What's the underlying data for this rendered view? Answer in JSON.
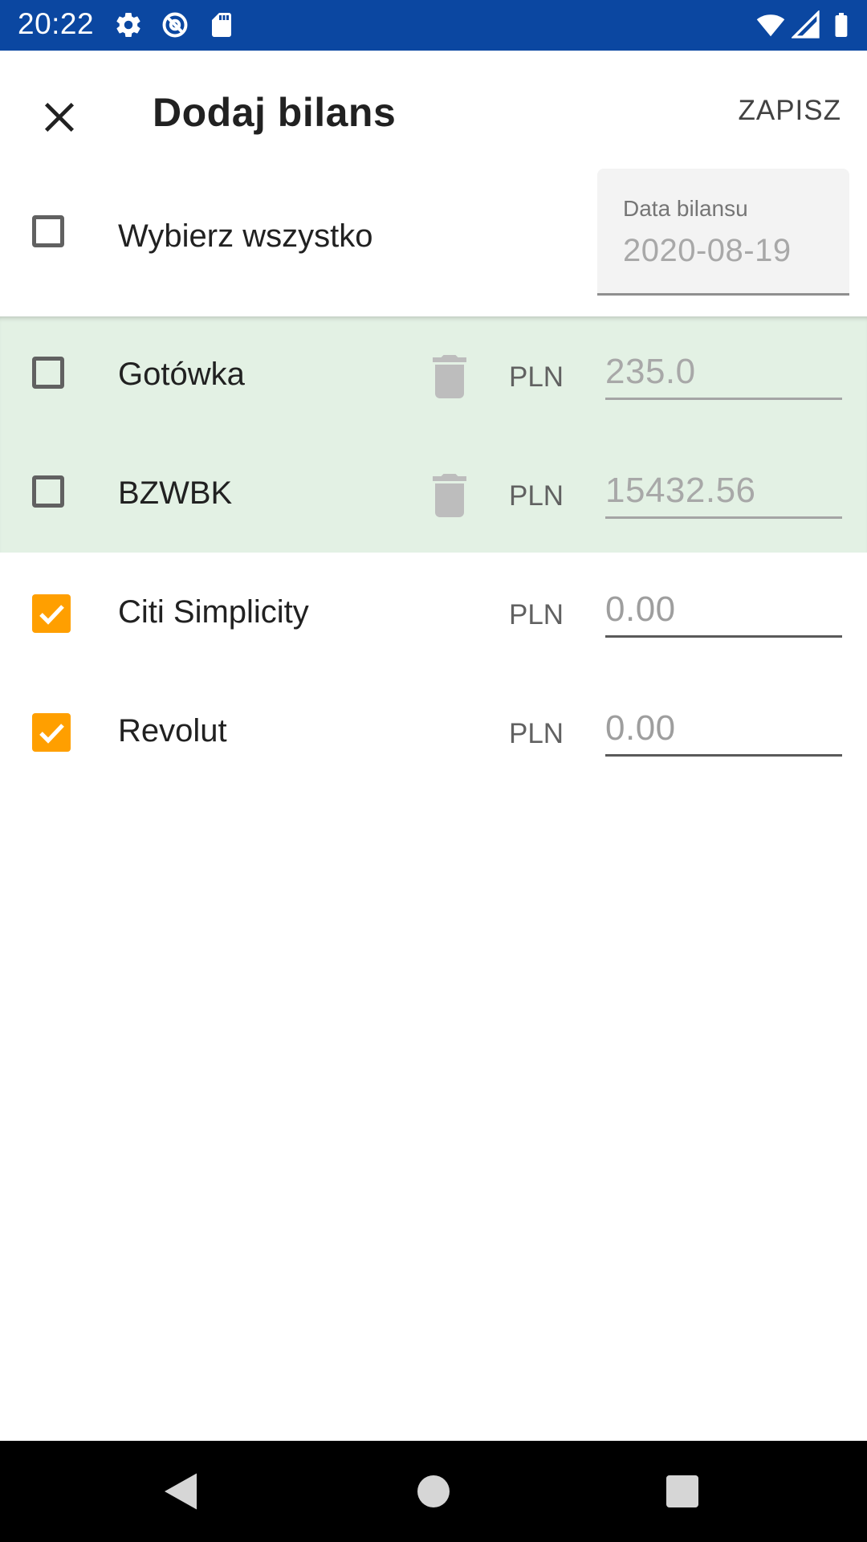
{
  "status_bar": {
    "time": "20:22",
    "icons": [
      "gear-icon",
      "vpn-icon",
      "sd-card-icon",
      "wifi-icon",
      "signal-icon",
      "battery-icon"
    ]
  },
  "app_bar": {
    "close_icon": "close-icon",
    "title": "Dodaj bilans",
    "save_label": "ZAPISZ"
  },
  "select_all": {
    "label": "Wybierz wszystko",
    "checked": false
  },
  "date_field": {
    "label": "Data bilansu",
    "value": "2020-08-19"
  },
  "accounts": [
    {
      "name": "Gotówka",
      "currency": "PLN",
      "amount": "235.0",
      "checked": false,
      "deletable": true
    },
    {
      "name": "BZWBK",
      "currency": "PLN",
      "amount": "15432.56",
      "checked": false,
      "deletable": true
    },
    {
      "name": "Citi Simplicity",
      "currency": "PLN",
      "amount": "0.00",
      "checked": true,
      "deletable": false
    },
    {
      "name": "Revolut",
      "currency": "PLN",
      "amount": "0.00",
      "checked": true,
      "deletable": false
    }
  ],
  "colors": {
    "status_bar": "#0b47a1",
    "accent": "#ff9f00",
    "selected_rows_bg": "#e3f1e4"
  },
  "nav_bar": {
    "icons": [
      "back-icon",
      "home-icon",
      "recents-icon"
    ]
  }
}
